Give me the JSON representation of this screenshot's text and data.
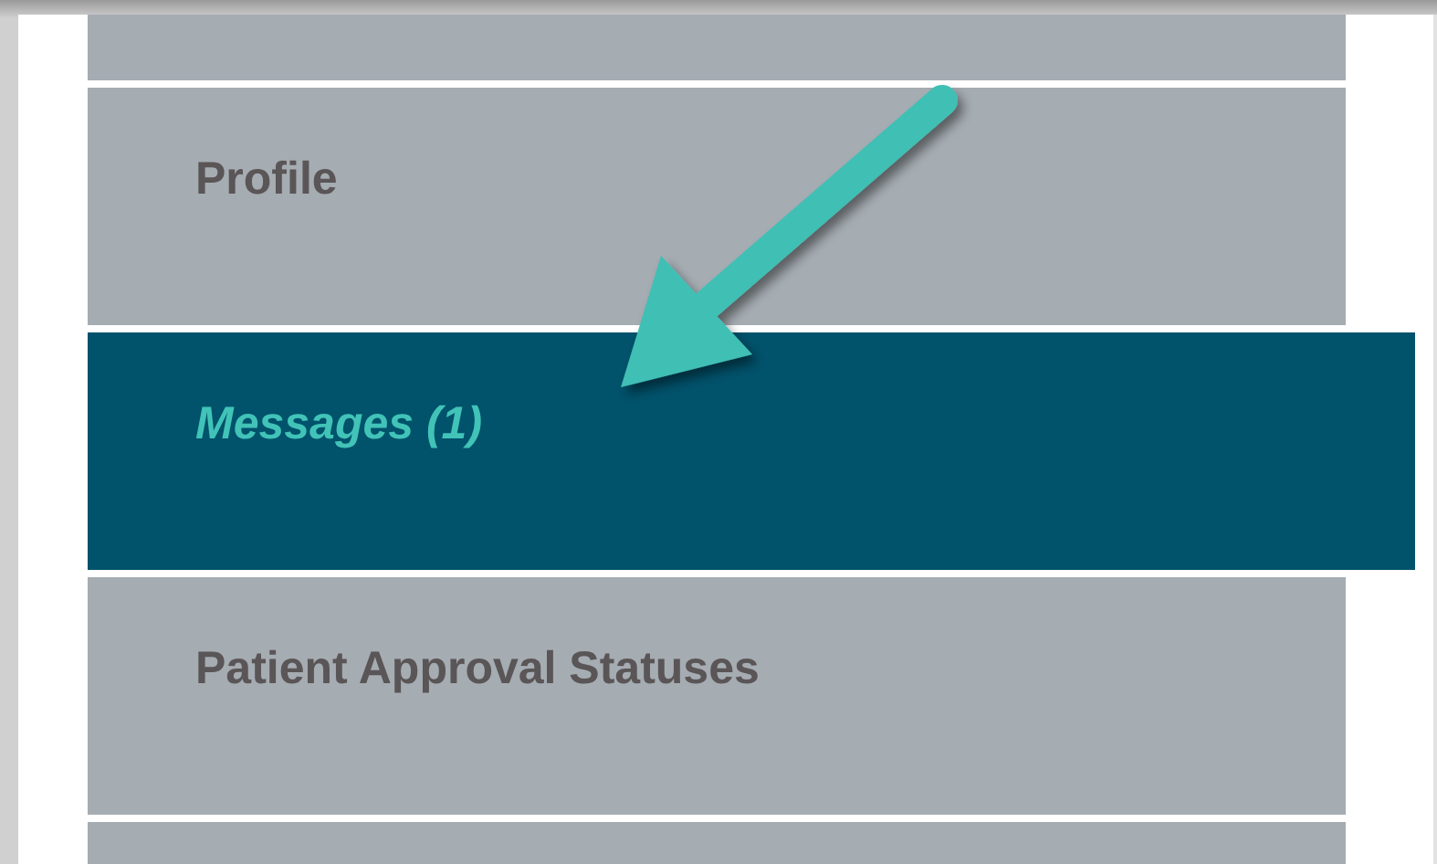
{
  "menu": {
    "items": [
      {
        "selected": false
      },
      {
        "label": "Profile",
        "selected": false
      },
      {
        "label": "Messages (1)",
        "selected": true
      },
      {
        "label": "Patient Approval Statuses",
        "selected": false
      },
      {
        "selected": false
      }
    ]
  }
}
